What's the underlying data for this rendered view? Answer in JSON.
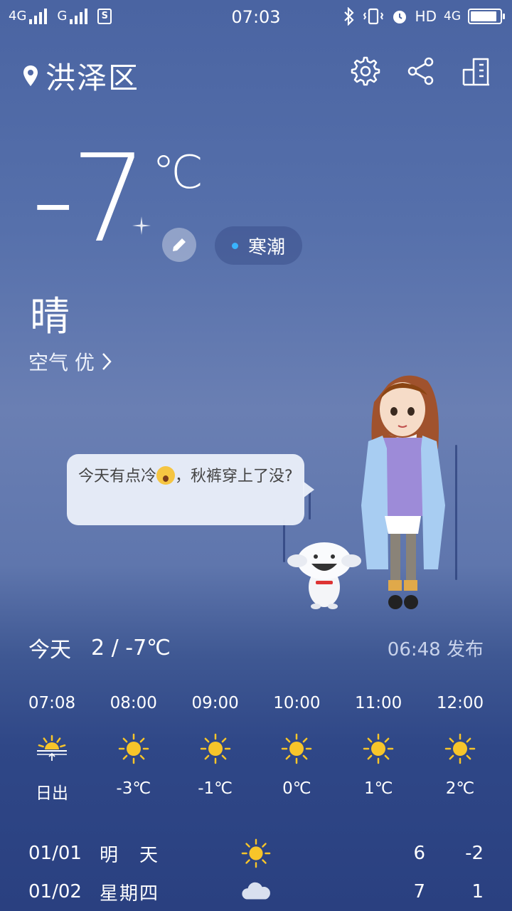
{
  "status_bar": {
    "net1": "4G",
    "net2": "G",
    "time": "07:03",
    "right_text": "HD",
    "net3": "4G",
    "battery_level": 0.9
  },
  "header": {
    "city": "洪泽区",
    "icons": [
      "location-pin-icon",
      "gear-icon",
      "share-icon",
      "building-icon"
    ]
  },
  "current": {
    "temp": "-7",
    "unit": "℃",
    "alert": "寒潮",
    "alert_color": "#39b4ff",
    "condition": "晴",
    "air_label": "空气 优"
  },
  "bubble": {
    "text_before": "今天有点冷",
    "text_after": "，秋裤穿上了没?"
  },
  "today": {
    "label": "今天",
    "range": "2 / -7℃",
    "published": "06:48 发布"
  },
  "hourly": [
    {
      "time": "07:08",
      "icon": "sunrise-icon",
      "value": "日出"
    },
    {
      "time": "08:00",
      "icon": "sun-icon",
      "value": "-3℃"
    },
    {
      "time": "09:00",
      "icon": "sun-icon",
      "value": "-1℃"
    },
    {
      "time": "10:00",
      "icon": "sun-icon",
      "value": "0℃"
    },
    {
      "time": "11:00",
      "icon": "sun-icon",
      "value": "1℃"
    },
    {
      "time": "12:00",
      "icon": "sun-icon",
      "value": "2℃"
    }
  ],
  "daily": [
    {
      "date": "01/01",
      "name": "明　天",
      "icon": "sun-icon",
      "high": "6",
      "low": "-2"
    },
    {
      "date": "01/02",
      "name": "星期四",
      "icon": "cloud-icon",
      "high": "7",
      "low": "1"
    }
  ],
  "colors": {
    "sun": "#f7c52a",
    "cloud": "#d9e0ef"
  }
}
